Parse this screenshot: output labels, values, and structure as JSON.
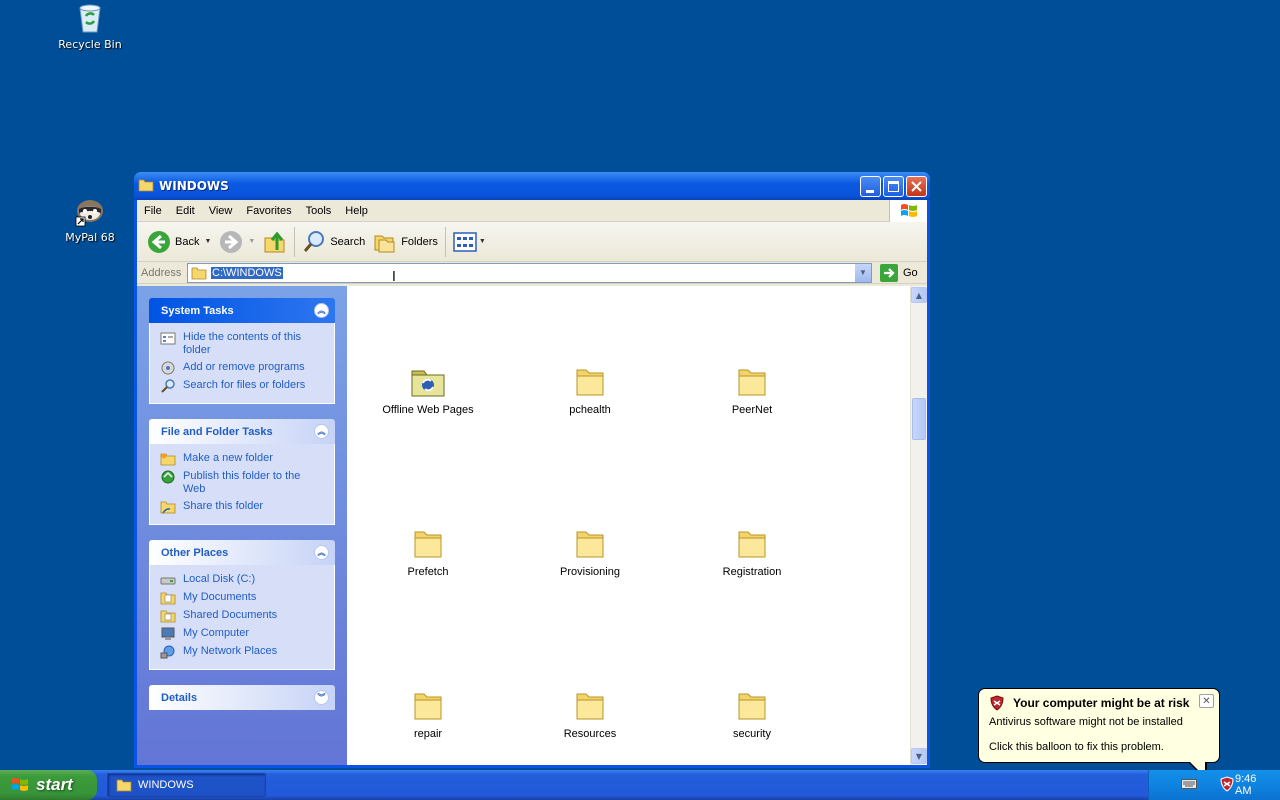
{
  "desktop": {
    "icons": [
      {
        "label": "Recycle Bin",
        "icon": "recycle-bin-icon"
      },
      {
        "label": "MyPal 68",
        "icon": "mypal-icon"
      }
    ]
  },
  "window": {
    "title": "WINDOWS",
    "menu": [
      "File",
      "Edit",
      "View",
      "Favorites",
      "Tools",
      "Help"
    ],
    "toolbar": {
      "back": "Back",
      "search": "Search",
      "folders": "Folders"
    },
    "address": {
      "label": "Address",
      "value": "C:\\WINDOWS",
      "go": "Go"
    },
    "task_pane": {
      "system_tasks": {
        "title": "System Tasks",
        "links": [
          "Hide the contents of this folder",
          "Add or remove programs",
          "Search for files or folders"
        ]
      },
      "file_folder_tasks": {
        "title": "File and Folder Tasks",
        "links": [
          "Make a new folder",
          "Publish this folder to the Web",
          "Share this folder"
        ]
      },
      "other_places": {
        "title": "Other Places",
        "links": [
          "Local Disk (C:)",
          "My Documents",
          "Shared Documents",
          "My Computer",
          "My Network Places"
        ]
      },
      "details": {
        "title": "Details"
      }
    },
    "files": [
      "Offline Web Pages",
      "pchealth",
      "PeerNet",
      "Prefetch",
      "Provisioning",
      "Registration",
      "repair",
      "Resources",
      "security"
    ]
  },
  "taskbar": {
    "start": "start",
    "task": "WINDOWS",
    "clock": "9:46 AM"
  },
  "balloon": {
    "title": "Your computer might be at risk",
    "line1": "Antivirus software might not be installed",
    "line2": "Click this balloon to fix this problem."
  },
  "colors": {
    "desktop": "#004e98",
    "titlebar": "#0a55e8",
    "link": "#215dc6",
    "balloon": "#ffffe1"
  }
}
